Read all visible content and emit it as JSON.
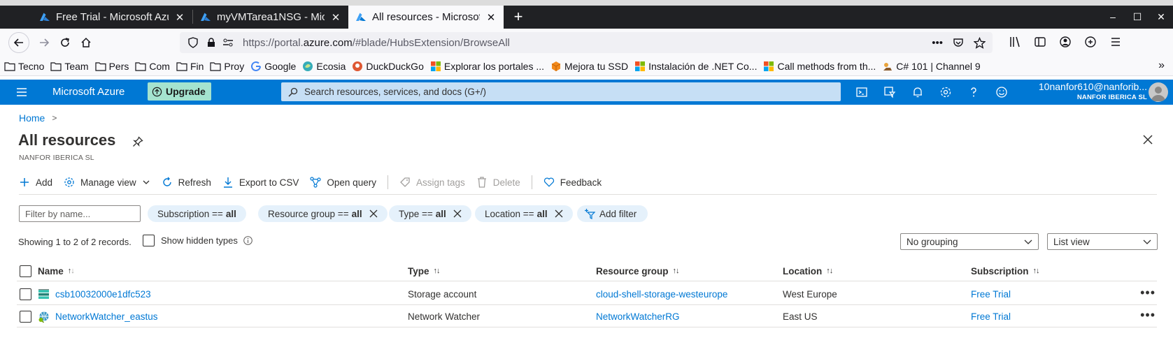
{
  "browser": {
    "tabs": [
      {
        "label": "Free Trial - Microsoft Azure",
        "active": false
      },
      {
        "label": "myVMTarea1NSG - Microsoft Azure",
        "active": false
      },
      {
        "label": "All resources - Microsoft Azure",
        "active": true
      }
    ],
    "url_prefix": "https://portal.",
    "url_domain": "azure.com",
    "url_path": "/#blade/HubsExtension/BrowseAll",
    "url_more": "•••",
    "bookmarks": [
      {
        "label": "Tecno",
        "icon": "folder-icon"
      },
      {
        "label": "Team",
        "icon": "folder-icon"
      },
      {
        "label": "Pers",
        "icon": "folder-icon"
      },
      {
        "label": "Com",
        "icon": "folder-icon"
      },
      {
        "label": "Fin",
        "icon": "folder-icon"
      },
      {
        "label": "Proy",
        "icon": "folder-icon"
      },
      {
        "label": "Google",
        "icon": "google-icon"
      },
      {
        "label": "Ecosia",
        "icon": "ecosia-icon"
      },
      {
        "label": "DuckDuckGo",
        "icon": "duckduckgo-icon"
      },
      {
        "label": "Explorar los portales ...",
        "icon": "microsoft-icon"
      },
      {
        "label": "Mejora tu SSD",
        "icon": "orange-cube-icon"
      },
      {
        "label": "Instalación de .NET Co...",
        "icon": "microsoft-icon"
      },
      {
        "label": "Call methods from th...",
        "icon": "microsoft-icon"
      },
      {
        "label": "C# 101 | Channel 9",
        "icon": "channel9-icon"
      }
    ],
    "bookmarks_more": "»"
  },
  "azure": {
    "brand": "Microsoft Azure",
    "upgrade_label": "Upgrade",
    "search_placeholder": "Search resources, services, and docs (G+/)",
    "account_email": "10nanfor610@nanforib...",
    "account_org": "NANFOR IBERICA SL"
  },
  "page": {
    "breadcrumb_home": "Home",
    "title": "All resources",
    "subtitle": "NANFOR IBERICA SL"
  },
  "toolbar": {
    "add": "Add",
    "manage_view": "Manage view",
    "refresh": "Refresh",
    "export_csv": "Export to CSV",
    "open_query": "Open query",
    "assign_tags": "Assign tags",
    "delete": "Delete",
    "feedback": "Feedback"
  },
  "filters": {
    "placeholder": "Filter by name...",
    "pills": [
      {
        "label": "Subscription ==",
        "value": "all",
        "removable": false
      },
      {
        "label": "Resource group ==",
        "value": "all",
        "removable": true
      },
      {
        "label": "Type ==",
        "value": "all",
        "removable": true
      },
      {
        "label": "Location ==",
        "value": "all",
        "removable": true
      }
    ],
    "add_filter": "Add filter"
  },
  "list": {
    "showing": "Showing 1 to 2 of 2 records.",
    "show_hidden_types": "Show hidden types",
    "grouping": "No grouping",
    "view": "List view",
    "columns": {
      "name": "Name",
      "type": "Type",
      "resource_group": "Resource group",
      "location": "Location",
      "subscription": "Subscription"
    },
    "rows": [
      {
        "name": "csb10032000e1dfc523",
        "type": "Storage account",
        "resource_group": "cloud-shell-storage-westeurope",
        "location": "West Europe",
        "subscription": "Free Trial",
        "icon": "storage-account-icon"
      },
      {
        "name": "NetworkWatcher_eastus",
        "type": "Network Watcher",
        "resource_group": "NetworkWatcherRG",
        "location": "East US",
        "subscription": "Free Trial",
        "icon": "network-watcher-icon"
      }
    ],
    "more_label": "•••"
  },
  "colors": {
    "azure_blue": "#0078d4",
    "upgrade_green": "#a4e3cf",
    "pill_bg": "#e5f1fb"
  }
}
